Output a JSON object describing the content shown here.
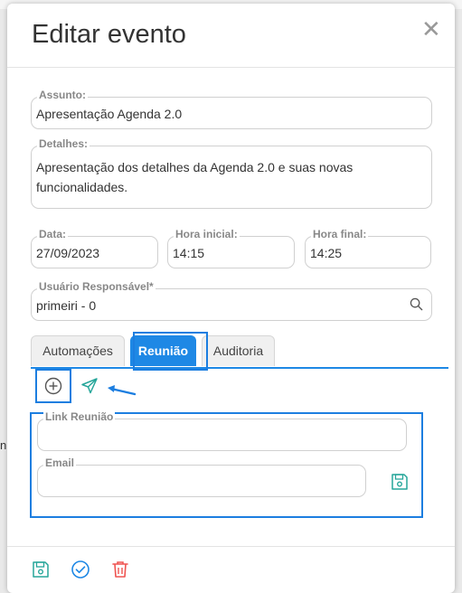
{
  "modal": {
    "title": "Editar evento",
    "close_icon": "close-icon"
  },
  "form": {
    "subject": {
      "label": "Assunto:",
      "value": "Apresentação Agenda 2.0"
    },
    "details": {
      "label": "Detalhes:",
      "value": "Apresentação dos detalhes da Agenda 2.0 e suas novas funcionalidades."
    },
    "date": {
      "label": "Data:",
      "value": "27/09/2023"
    },
    "start_time": {
      "label": "Hora inicial:",
      "value": "14:15"
    },
    "end_time": {
      "label": "Hora final:",
      "value": "14:25"
    },
    "responsible_user": {
      "label": "Usuário Responsável*",
      "value": "primeiri - 0",
      "icon": "search-icon"
    }
  },
  "tabs": [
    {
      "label": "Automações",
      "active": false
    },
    {
      "label": "Reunião",
      "active": true
    },
    {
      "label": "Auditoria",
      "active": false
    }
  ],
  "meeting": {
    "add_icon": "plus-circle-icon",
    "send_icon": "send-icon",
    "link": {
      "label": "Link Reunião",
      "value": ""
    },
    "email": {
      "label": "Email",
      "value": ""
    },
    "save_icon": "save-icon"
  },
  "footer": {
    "save_icon": "save-icon",
    "confirm_icon": "check-circle-icon",
    "delete_icon": "trash-icon"
  },
  "colors": {
    "accent": "#1e88e5",
    "highlight": "#1c7ee0",
    "success": "#26a69a",
    "danger": "#ef5350"
  }
}
